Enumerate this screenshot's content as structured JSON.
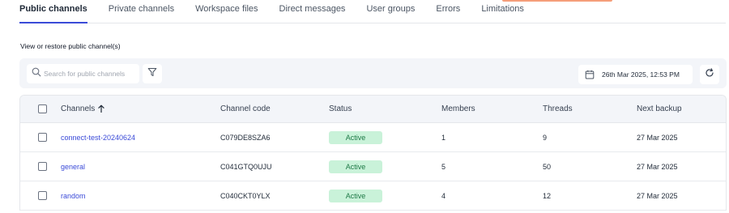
{
  "tabs": [
    {
      "label": "Public channels"
    },
    {
      "label": "Private channels"
    },
    {
      "label": "Workspace files"
    },
    {
      "label": "Direct messages"
    },
    {
      "label": "User groups"
    },
    {
      "label": "Errors"
    },
    {
      "label": "Limitations"
    }
  ],
  "active_tab": "Public channels",
  "section_label": "View or restore public channel(s)",
  "search": {
    "placeholder": "Search for public channels",
    "value": ""
  },
  "date_picker": {
    "value": "26th Mar 2025, 12:53 PM"
  },
  "icons": {
    "search": "search-icon",
    "filter": "filter-icon",
    "calendar": "calendar-icon",
    "refresh": "refresh-icon",
    "sort": "arrow-up-icon"
  },
  "colors": {
    "accent": "#3b4bd8",
    "link": "#3b4bd8",
    "active_badge_bg": "#c9f2d9",
    "active_badge_text": "#1f7a47"
  },
  "table": {
    "headers": {
      "channels": "Channels",
      "channel_code": "Channel code",
      "status": "Status",
      "members": "Members",
      "threads": "Threads",
      "next_backup": "Next backup"
    },
    "sort": {
      "column": "Channels",
      "direction": "ascending"
    },
    "rows": [
      {
        "channel": "connect-test-20240624",
        "code": "C079DE8SZA6",
        "status": "Active",
        "members": "1",
        "threads": "9",
        "next_backup": "27 Mar 2025"
      },
      {
        "channel": "general",
        "code": "C041GTQ0UJU",
        "status": "Active",
        "members": "5",
        "threads": "50",
        "next_backup": "27 Mar 2025"
      },
      {
        "channel": "random",
        "code": "C040CKT0YLX",
        "status": "Active",
        "members": "4",
        "threads": "12",
        "next_backup": "27 Mar 2025"
      }
    ]
  }
}
